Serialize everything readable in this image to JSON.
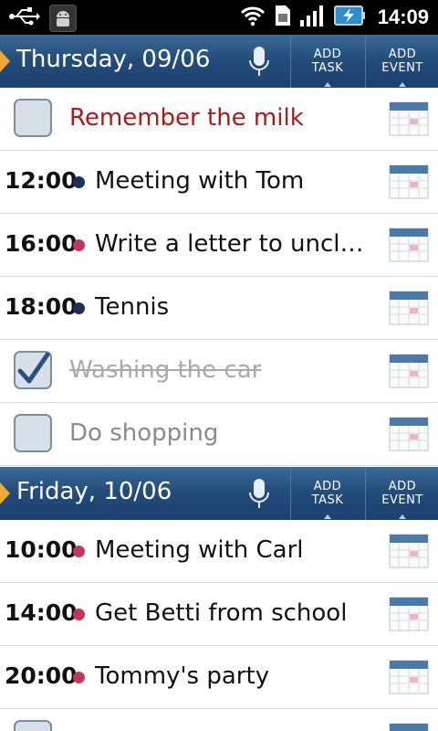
{
  "status_bar": {
    "time": "14:09",
    "icons": [
      "usb-icon",
      "android-icon",
      "wifi-icon",
      "sim-icon",
      "signal-icon",
      "battery-charging-icon"
    ]
  },
  "days": [
    {
      "title": "Thursday, 09/06",
      "add_task": [
        "ADD",
        "TASK"
      ],
      "add_event": [
        "ADD",
        "EVENT"
      ]
    },
    {
      "title": "Friday, 10/06",
      "add_task": [
        "ADD",
        "TASK"
      ],
      "add_event": [
        "ADD",
        "EVENT"
      ]
    }
  ],
  "thursday_items": [
    {
      "kind": "task",
      "text": "Remember the milk",
      "checked": false,
      "style": "priority"
    },
    {
      "kind": "event",
      "time": "12:00",
      "text": "Meeting with Tom",
      "dot_color": "#1e2f5a"
    },
    {
      "kind": "event",
      "time": "16:00",
      "text": "Write a letter to uncl…",
      "dot_color": "#c0395a"
    },
    {
      "kind": "event",
      "time": "18:00",
      "text": "Tennis",
      "dot_color": "#1e2f5a"
    },
    {
      "kind": "task",
      "text": "Washing the car",
      "checked": true,
      "style": "done"
    },
    {
      "kind": "task",
      "text": "Do shopping",
      "checked": false,
      "style": "normal"
    }
  ],
  "friday_items": [
    {
      "kind": "event",
      "time": "10:00",
      "text": "Meeting with Carl",
      "dot_color": "#c0395a"
    },
    {
      "kind": "event",
      "time": "14:00",
      "text": "Get Betti from school",
      "dot_color": "#c0395a"
    },
    {
      "kind": "event",
      "time": "20:00",
      "text": "Tommy's party",
      "dot_color": "#c0395a"
    }
  ],
  "colors": {
    "header": "#244d7a",
    "accent": "#f0a830",
    "priority_text": "#b01818",
    "dot_navy": "#1e2f5a",
    "dot_red": "#c0395a"
  }
}
